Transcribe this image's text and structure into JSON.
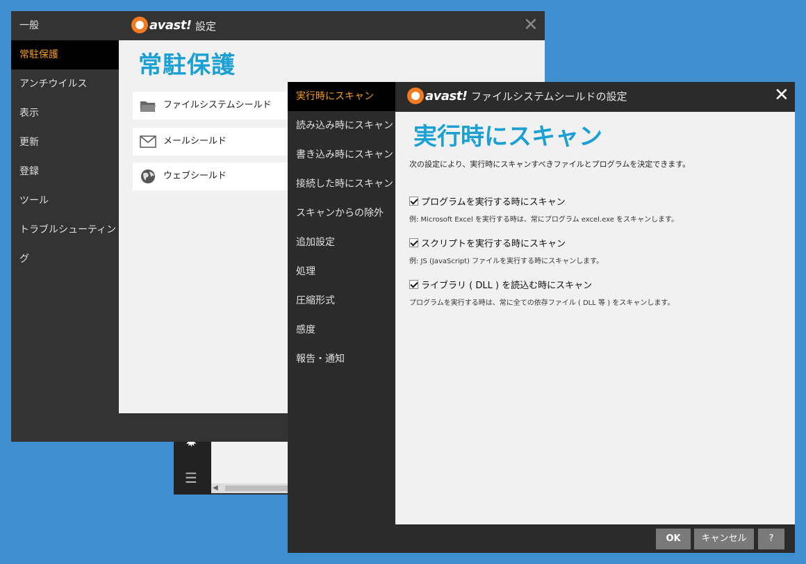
{
  "settings": {
    "title": "設定",
    "logo_text": "avast!",
    "sidebar": [
      {
        "label": "一般",
        "active": false
      },
      {
        "label": "常駐保護",
        "active": true
      },
      {
        "label": "アンチウイルス",
        "active": false
      },
      {
        "label": "表示",
        "active": false
      },
      {
        "label": "更新",
        "active": false
      },
      {
        "label": "登録",
        "active": false
      },
      {
        "label": "ツール",
        "active": false
      },
      {
        "label": "トラブルシューティング",
        "active": false
      }
    ],
    "heading": "常駐保護",
    "shields": [
      {
        "label": "ファイルシステムシールド",
        "icon": "folder-icon"
      },
      {
        "label": "メールシールド",
        "icon": "mail-icon"
      },
      {
        "label": "ウェブシールド",
        "icon": "globe-icon"
      }
    ]
  },
  "dialog": {
    "title": "ファイルシステムシールドの設定",
    "logo_text": "avast!",
    "sidebar": [
      {
        "label": "実行時にスキャン",
        "active": true
      },
      {
        "label": "読み込み時にスキャン",
        "active": false
      },
      {
        "label": "書き込み時にスキャン",
        "active": false
      },
      {
        "label": "接続した時にスキャン",
        "active": false
      },
      {
        "label": "スキャンからの除外",
        "active": false
      },
      {
        "label": "追加設定",
        "active": false
      },
      {
        "label": "処理",
        "active": false
      },
      {
        "label": "圧縮形式",
        "active": false
      },
      {
        "label": "感度",
        "active": false
      },
      {
        "label": "報告・通知",
        "active": false
      }
    ],
    "heading": "実行時にスキャン",
    "description": "次の設定により、実行時にスキャンすべきファイルとプログラムを決定できます。",
    "options": [
      {
        "label": "プログラムを実行する時にスキャン",
        "checked": true,
        "note": "例: Microsoft Excel を実行する時は、常にプログラム excel.exe をスキャンします。"
      },
      {
        "label": "スクリプトを実行する時にスキャン",
        "checked": true,
        "note": "例: JS (JavaScript) ファイルを実行する時にスキャンします。"
      },
      {
        "label": "ライブラリ ( DLL ) を読込む時にスキャン",
        "checked": true,
        "note": "プログラムを実行する時は、常に全ての依存ファイル ( DLL 等 ) をスキャンします。"
      }
    ],
    "buttons": {
      "ok": "OK",
      "cancel": "キャンセル",
      "help": "?"
    }
  },
  "colors": {
    "accent": "#1aa0d4",
    "active_nav": "#f39c1c",
    "desktop": "#3f8ecf"
  }
}
